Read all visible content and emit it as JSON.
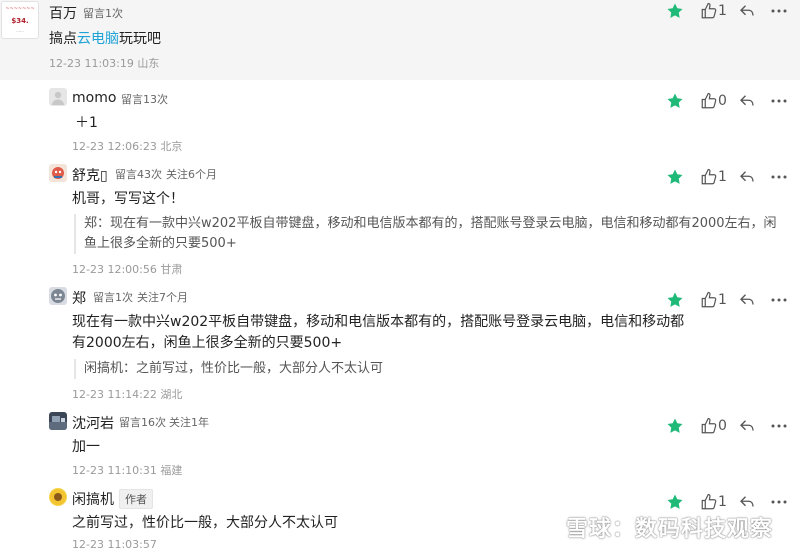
{
  "colors": {
    "accent_star": "#1fb978",
    "link_highlight": "#1fa3d6",
    "top_bg": "#f5f5f5"
  },
  "comments": [
    {
      "avatar_text": [
        "~~~~~~~",
        "$34.",
        "......"
      ],
      "name": "百万",
      "posts": "留言1次",
      "text_prefix": "搞点",
      "text_highlight": "云电脑",
      "text_suffix": "玩玩吧",
      "time": "12-23 11:03:19 山东",
      "likes": "1"
    },
    {
      "name": "momo",
      "posts": "留言13次",
      "text": "＋1",
      "time": "12-23 12:06:23 北京",
      "likes": "0"
    },
    {
      "name": "舒克▯",
      "posts": "留言43次",
      "follow": "关注6个月",
      "text": "机哥，写写这个！",
      "quote_line1": "郑：现在有一款中兴w202平板自带键盘，移动和电信版本都有的，搭配账号登录云电脑，电信和移动都有2000左右，闲",
      "quote_line2": "鱼上很多全新的只要500+",
      "time": "12-23 12:00:56 甘肃",
      "likes": "1"
    },
    {
      "name": "郑",
      "posts": "留言1次",
      "follow": "关注7个月",
      "text_line1": "现在有一款中兴w202平板自带键盘，移动和电信版本都有的，搭配账号登录云电脑，电信和移动都",
      "text_line2": "有2000左右，闲鱼上很多全新的只要500+",
      "quote": "闲搞机：之前写过，性价比一般，大部分人不太认可",
      "time": "12-23 11:14:22 湖北",
      "likes": "1"
    },
    {
      "name": "沈河岩",
      "posts": "留言16次",
      "follow": "关注1年",
      "text": "加一",
      "time": "12-23 11:10:31 福建",
      "likes": "0"
    },
    {
      "name": "闲搞机",
      "author_tag": "作者",
      "text": "之前写过，性价比一般，大部分人不太认可",
      "time": "12-23 11:03:57",
      "likes": "1"
    }
  ],
  "watermark": "雪球：数码科技观察",
  "icons": [
    "star-icon",
    "thumbs-up-icon",
    "reply-arrow-icon",
    "more-dots-icon",
    "default-avatar-icon"
  ]
}
